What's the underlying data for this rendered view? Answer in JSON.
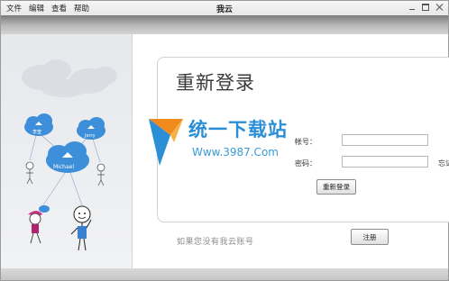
{
  "menu": [
    "文件",
    "编辑",
    "查看",
    "帮助"
  ],
  "window_title": "我云",
  "illustration": {
    "user1": "李莹",
    "user2": "Jerry",
    "user3": "Michael"
  },
  "login": {
    "title": "重新登录",
    "username_label": "帐号：",
    "password_label": "密码：",
    "side_link": "忘记",
    "relogin_button": "重新登录",
    "hint": "如果您没有我云账号",
    "register_button": "注册"
  },
  "watermark": {
    "text": "统一下载站",
    "url": "Www.3987.Com"
  },
  "colors": {
    "brand_blue": "#2a8fd6",
    "cloud_blue": "#3c8fd8"
  }
}
